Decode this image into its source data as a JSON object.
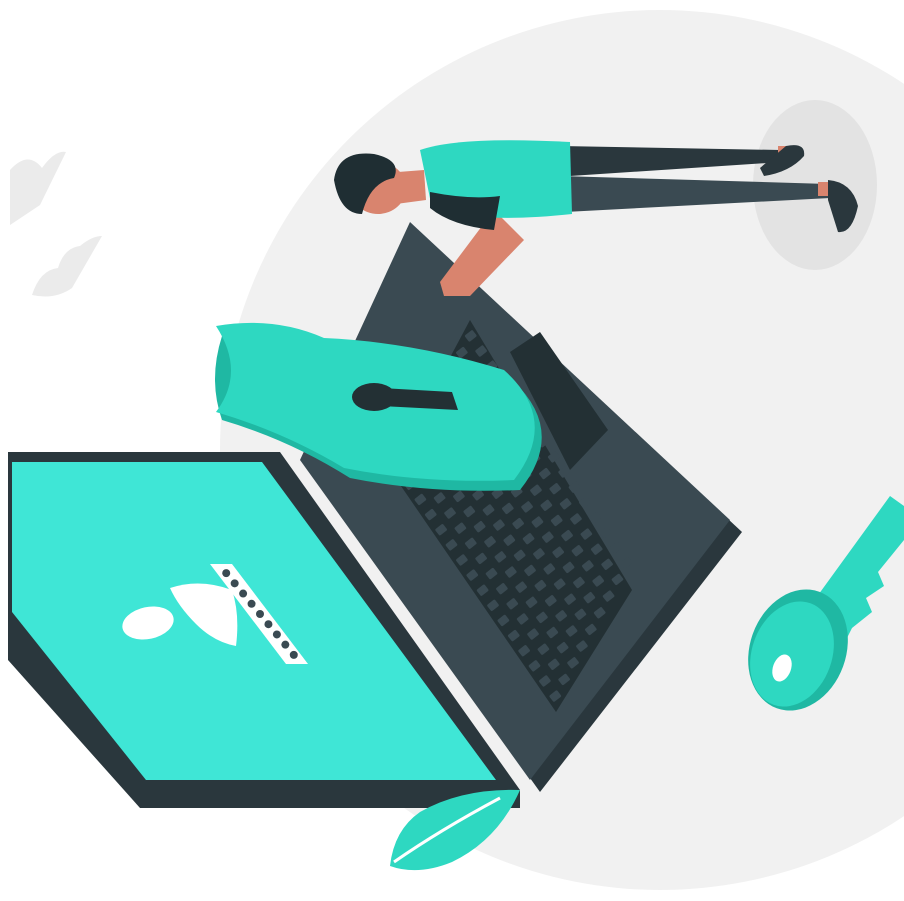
{
  "illustration": {
    "subject": "laptop-security",
    "icons": [
      "background-circle-icon",
      "person-icon",
      "laptop-icon",
      "shield-lock-icon",
      "keyhole-icon",
      "user-avatar-icon",
      "password-dots-icon",
      "key-icon",
      "leaf-icon",
      "cloud-icon"
    ]
  },
  "login_screen": {
    "password_dot_count": 9
  },
  "colors": {
    "accent": "#2ed8c1",
    "accent_light": "#3fe6d6",
    "accent_dark": "#1fb8a3",
    "laptop_body": "#3a4a52",
    "laptop_edge": "#2a373d",
    "keyboard": "#233034",
    "skin": "#d9846e",
    "hair": "#1f2e33",
    "background_circle": "#f1f1f1",
    "shadow_spot": "#e3e3e3",
    "cloud": "#ebebeb"
  }
}
